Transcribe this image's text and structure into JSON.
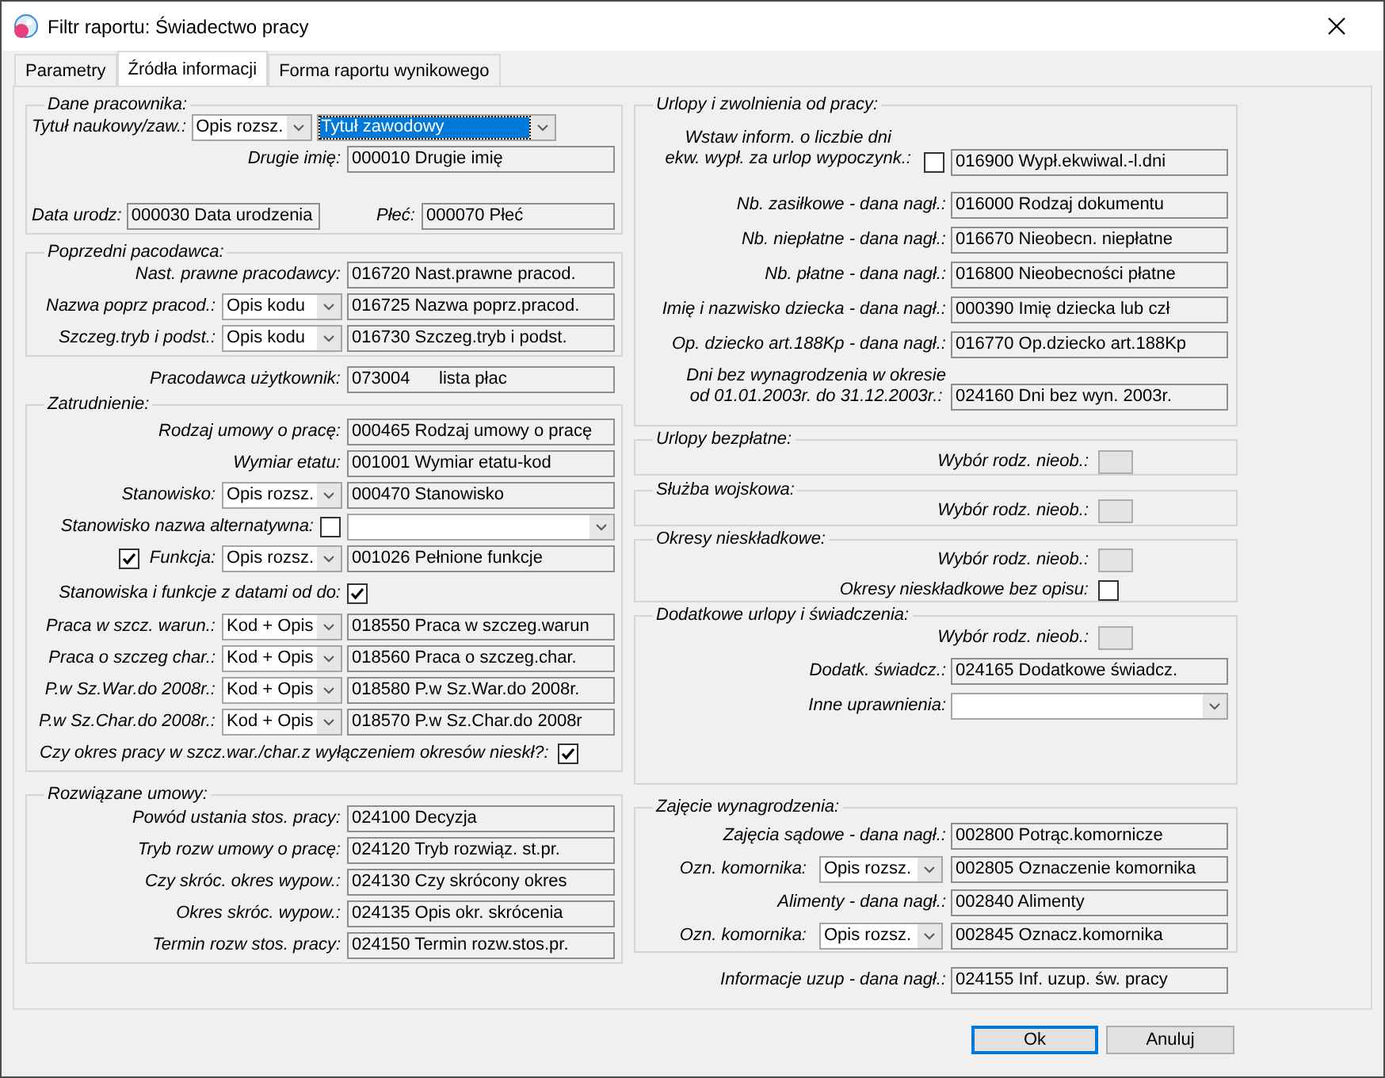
{
  "window": {
    "title": "Filtr raportu: Świadectwo pracy"
  },
  "tabs": [
    {
      "label": "Parametry",
      "selected": false
    },
    {
      "label": "Źródła informacji",
      "selected": true
    },
    {
      "label": "Forma raportu wynikowego",
      "selected": false
    }
  ],
  "left_column": [
    {
      "kind": "group",
      "title": "Dane pracownika:",
      "rows": [
        {
          "kind": "two_combos",
          "label": "Tytuł naukowy/zaw.:",
          "combo": "Opis rozsz.",
          "combo_2": {
            "value": "Tytuł zawodowy",
            "focused": true
          }
        },
        {
          "kind": "field",
          "label": "Drugie imię:",
          "value": "000010 Drugie imię"
        },
        {
          "kind": "field_pair",
          "label": "Data urodz:",
          "value": "000030 Data urodzenia",
          "label_2": "Płeć:",
          "value_2": "000070 Płeć"
        }
      ]
    },
    {
      "kind": "group",
      "title": "Poprzedni pacodawca:",
      "rows": [
        {
          "kind": "field",
          "label": "Nast. prawne pracodawcy:",
          "value": "016720 Nast.prawne pracod."
        },
        {
          "kind": "combo_field",
          "label": "Nazwa poprz pracod.:",
          "combo": "Opis kodu",
          "value": "016725 Nazwa poprz.pracod."
        },
        {
          "kind": "combo_field",
          "label": "Szczeg.tryb i podst.:",
          "combo": "Opis kodu",
          "value": "016730 Szczeg.tryb i podst."
        }
      ]
    },
    {
      "kind": "field",
      "label": "Pracodawca użytkownik:",
      "value": "073004      lista płac"
    },
    {
      "kind": "group",
      "title": "Zatrudnienie:",
      "rows": [
        {
          "kind": "field",
          "label": "Rodzaj umowy o pracę:",
          "value": "000465 Rodzaj umowy o pracę"
        },
        {
          "kind": "field",
          "label": "Wymiar etatu:",
          "value": "001001 Wymiar etatu-kod"
        },
        {
          "kind": "combo_field",
          "label": "Stanowisko:",
          "combo": "Opis rozsz.",
          "value": "000470 Stanowisko"
        },
        {
          "kind": "checkbox_combo",
          "label": "Stanowisko nazwa alternatywna:",
          "checked": false
        },
        {
          "kind": "check_combo_field",
          "label": "Funkcja:",
          "checked": true,
          "combo": "Opis rozsz.",
          "value": "001026 Pełnione funkcje"
        },
        {
          "kind": "checkbox",
          "label": "Stanowiska i funkcje z datami od do:",
          "checked": true
        },
        {
          "kind": "combo_field",
          "label": "Praca w szcz. warun.:",
          "combo": "Kod + Opis",
          "value": "018550 Praca w szczeg.warun"
        },
        {
          "kind": "combo_field",
          "label": "Praca o szczeg char.:",
          "combo": "Kod + Opis",
          "value": "018560 Praca o szczeg.char."
        },
        {
          "kind": "combo_field",
          "label": "P.w Sz.War.do 2008r.:",
          "combo": "Kod + Opis",
          "value": "018580 P.w Sz.War.do 2008r."
        },
        {
          "kind": "combo_field",
          "label": "P.w Sz.Char.do 2008r.:",
          "combo": "Kod + Opis",
          "value": "018570 P.w Sz.Char.do 2008r"
        },
        {
          "kind": "checkbox_inline",
          "label": "Czy okres pracy w szcz.war./char.z wyłączeniem okresów nieskł?:",
          "checked": true
        }
      ]
    },
    {
      "kind": "group",
      "title": "Rozwiązane umowy:",
      "rows": [
        {
          "kind": "field",
          "label": "Powód ustania stos. pracy:",
          "value": "024100 Decyzja"
        },
        {
          "kind": "field",
          "label": "Tryb rozw umowy o pracę:",
          "value": "024120 Tryb rozwiąz. st.pr."
        },
        {
          "kind": "field",
          "label": "Czy skróc. okres wypow.:",
          "value": "024130 Czy skrócony okres"
        },
        {
          "kind": "field",
          "label": "Okres skróc. wypow.:",
          "value": "024135 Opis okr. skrócenia"
        },
        {
          "kind": "field",
          "label": "Termin rozw stos. pracy:",
          "value": "024150 Termin rozw.stos.pr."
        }
      ]
    }
  ],
  "right_column": [
    {
      "kind": "group",
      "title": "Urlopy i zwolnienia od pracy:",
      "rows": [
        {
          "kind": "checkbox_field",
          "label": "Wstaw inform. o liczbie dni\nekw. wypł. za urlop wypoczynk.:",
          "checked": false,
          "value": "016900 Wypł.ekwiwal.-l.dni"
        },
        {
          "kind": "field",
          "label": "Nb. zasiłkowe - dana nagł.:",
          "value": "016000 Rodzaj dokumentu"
        },
        {
          "kind": "field",
          "label": "Nb. niepłatne - dana nagł.:",
          "value": "016670 Nieobecn. niepłatne"
        },
        {
          "kind": "field",
          "label": "Nb. płatne - dana nagł.:",
          "value": "016800 Nieobecności płatne"
        },
        {
          "kind": "field",
          "label": "Imię i nazwisko dziecka - dana nagł.:",
          "value": "000390 Imię dziecka lub czł"
        },
        {
          "kind": "field",
          "label": "Op. dziecko art.188Kp - dana nagł.:",
          "value": "016770 Op.dziecko art.188Kp"
        },
        {
          "kind": "field",
          "label": "Dni bez wynagrodzenia w okresie\nod 01.01.2003r. do 31.12.2003r.:",
          "value": "024160 Dni bez wyn. 2003r."
        }
      ]
    },
    {
      "kind": "group",
      "title": "Urlopy bezpłatne:",
      "rows": [
        {
          "kind": "blank",
          "label": "Wybór rodz. nieob.:"
        }
      ]
    },
    {
      "kind": "group",
      "title": "Służba wojskowa:",
      "rows": [
        {
          "kind": "blank",
          "label": "Wybór rodz. nieob.:"
        }
      ]
    },
    {
      "kind": "group",
      "title": "Okresy nieskładkowe:",
      "rows": [
        {
          "kind": "blank",
          "label": "Wybór rodz. nieob.:"
        },
        {
          "kind": "checkbox",
          "label": "Okresy nieskładkowe bez opisu:",
          "checked": false
        }
      ]
    },
    {
      "kind": "group",
      "title": "Dodatkowe urlopy i świadczenia:",
      "rows": [
        {
          "kind": "blank",
          "label": "Wybór rodz. nieob.:"
        },
        {
          "kind": "field",
          "label": "Dodatk. świadcz.:",
          "value": "024165 Dodatkowe świadcz."
        },
        {
          "kind": "combo",
          "label": "Inne uprawnienia:"
        }
      ]
    },
    {
      "kind": "group",
      "title": "Zajęcie wynagrodzenia:",
      "rows": [
        {
          "kind": "field",
          "label": "Zajęcia sądowe - dana nagł.:",
          "value": "002800 Potrąc.komornicze"
        },
        {
          "kind": "combo_field",
          "label": "Ozn. komornika:",
          "combo": "Opis rozsz.",
          "value": "002805 Oznaczenie komornika"
        },
        {
          "kind": "field",
          "label": "Alimenty - dana nagł.:",
          "value": "002840 Alimenty"
        },
        {
          "kind": "combo_field",
          "label": "Ozn. komornika:",
          "combo": "Opis rozsz.",
          "value": "002845 Oznacz.komornika"
        }
      ]
    },
    {
      "kind": "field",
      "label": "Informacje uzup - dana nagł.:",
      "value": "024155 Inf. uzup. św. pracy"
    }
  ],
  "buttons": [
    {
      "label": "Ok",
      "focused": true
    },
    {
      "label": "Anuluj",
      "focused": false
    }
  ]
}
